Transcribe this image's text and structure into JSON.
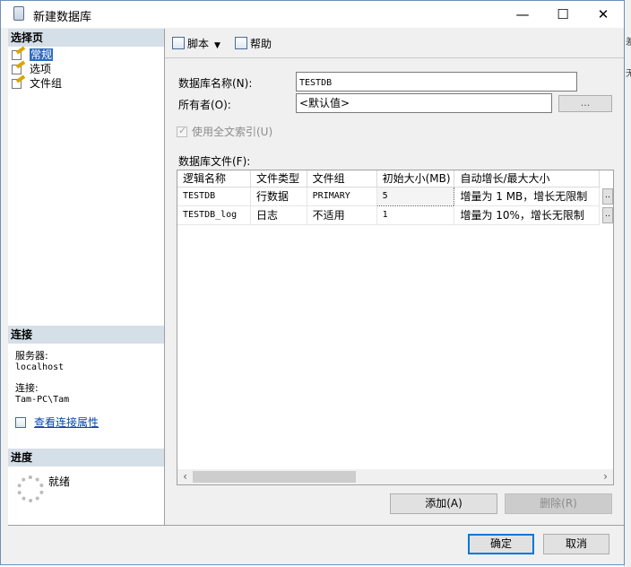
{
  "window": {
    "title": "新建数据库"
  },
  "left": {
    "select_page_header": "选择页",
    "pages": [
      {
        "label": "常规",
        "selected": true
      },
      {
        "label": "选项",
        "selected": false
      },
      {
        "label": "文件组",
        "selected": false
      }
    ],
    "connection_header": "连接",
    "server_label": "服务器:",
    "server_value": "localhost",
    "connection_label": "连接:",
    "connection_value": "Tam-PC\\Tam",
    "view_conn_props": "查看连接属性",
    "progress_header": "进度",
    "progress_status": "就绪"
  },
  "toolbar": {
    "script_label": "脚本",
    "help_label": "帮助"
  },
  "form": {
    "db_name_label": "数据库名称(N):",
    "db_name_value": "TESTDB",
    "owner_label": "所有者(O):",
    "owner_value": "<默认值>",
    "ellipsis_label": "...",
    "fulltext_label": "使用全文索引(U)",
    "files_label": "数据库文件(F):"
  },
  "grid": {
    "columns": [
      "逻辑名称",
      "文件类型",
      "文件组",
      "初始大小(MB)",
      "自动增长/最大大小"
    ],
    "rows": [
      {
        "logical_name": "TESTDB",
        "file_type": "行数据",
        "filegroup": "PRIMARY",
        "initial_size": "5",
        "autogrowth": "增量为 1 MB，增长无限制"
      },
      {
        "logical_name": "TESTDB_log",
        "file_type": "日志",
        "filegroup": "不适用",
        "initial_size": "1",
        "autogrowth": "增量为 10%，增长无限制"
      }
    ]
  },
  "buttons": {
    "add": "添加(A)",
    "remove": "删除(R)",
    "ok": "确定",
    "cancel": "取消"
  },
  "background_fragments": [
    "差",
    "无"
  ]
}
